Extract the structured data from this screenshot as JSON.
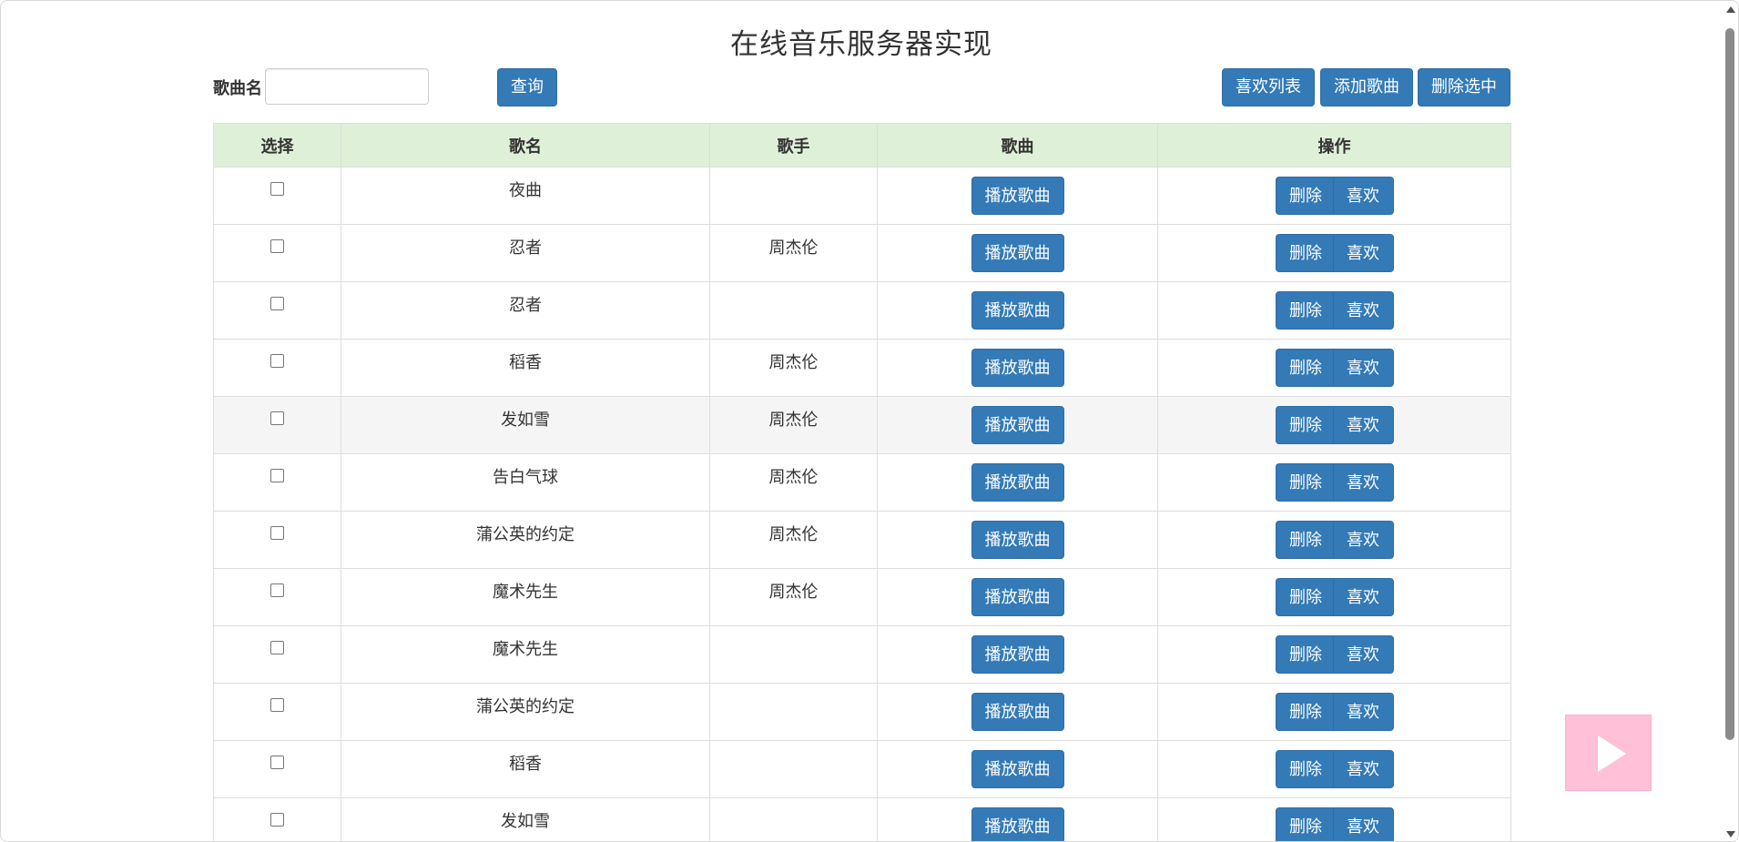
{
  "page": {
    "title": "在线音乐服务器实现"
  },
  "toolbar": {
    "search_label": "歌曲名",
    "search_value": "",
    "search_placeholder": "",
    "query_label": "查询",
    "fav_list_label": "喜欢列表",
    "add_song_label": "添加歌曲",
    "delete_selected_label": "删除选中"
  },
  "table": {
    "headers": [
      "选择",
      "歌名",
      "歌手",
      "歌曲",
      "操作"
    ],
    "play_label": "播放歌曲",
    "delete_label": "删除",
    "like_label": "喜欢",
    "rows": [
      {
        "title": "夜曲",
        "singer": ""
      },
      {
        "title": "忍者",
        "singer": "周杰伦"
      },
      {
        "title": "忍者",
        "singer": ""
      },
      {
        "title": "稻香",
        "singer": "周杰伦"
      },
      {
        "title": "发如雪",
        "singer": "周杰伦"
      },
      {
        "title": "告白气球",
        "singer": "周杰伦"
      },
      {
        "title": "蒲公英的约定",
        "singer": "周杰伦"
      },
      {
        "title": "魔术先生",
        "singer": "周杰伦"
      },
      {
        "title": "魔术先生",
        "singer": ""
      },
      {
        "title": "蒲公英的约定",
        "singer": ""
      },
      {
        "title": "稻香",
        "singer": ""
      },
      {
        "title": "发如雪",
        "singer": ""
      }
    ],
    "hovered_row_index": 4
  },
  "colors": {
    "primary_button": "#337ab7",
    "header_background": "#dff0d8",
    "floating_player": "#ffc0d8"
  },
  "icons": {
    "floating_player": "play-icon"
  }
}
